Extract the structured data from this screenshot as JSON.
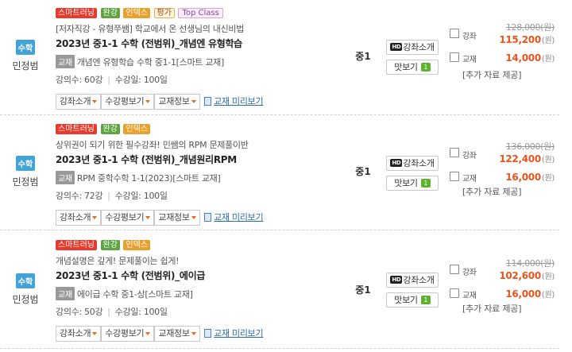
{
  "courses": [
    {
      "subject": "수학",
      "teacher": "민정범",
      "tags": [
        "스마트러닝",
        "완강",
        "인덱스",
        "평가",
        "Top Class"
      ],
      "description": "[저자직강 - 유형쭈쌤] 학교에서 온 선생님의 내신비법",
      "title": "2023년 중1-1 수학 (전범위)_개념엔 유형학습",
      "book_badge": "교재",
      "book": "개념엔 유형학습 수학 중1-1[스마트 교재]",
      "lecture_count": "강의수: 60강",
      "duration": "수강일: 100일",
      "btn_intro": "강좌소개",
      "btn_review": "수강평보기",
      "btn_bookinfo": "교재정보",
      "preview_link": "교재 미리보기",
      "grade": "중1",
      "act_intro": "강좌소개",
      "act_sample": "맛보기",
      "act_sample_badge": "1",
      "lecture_label": "강좌",
      "orig_price": "128,000(원)",
      "sale_price": "115,200",
      "won": "(원)",
      "book_label": "교재",
      "book_price": "14,000",
      "extra": "[추가 자료 제공]"
    },
    {
      "subject": "수학",
      "teacher": "민정범",
      "tags": [
        "스마트러닝",
        "완강",
        "인덱스"
      ],
      "description": "상위권이 되기 위한 필수강좌! 민쌤의 RPM 문제풀이반",
      "title": "2023년 중1-1 수학 (전범위)_개념원리RPM",
      "book_badge": "교재",
      "book": "RPM 중학수학 1-1(2023)[스마트 교재]",
      "lecture_count": "강의수: 72강",
      "duration": "수강일: 100일",
      "btn_intro": "강좌소개",
      "btn_review": "수강평보기",
      "btn_bookinfo": "교재정보",
      "preview_link": "교재 미리보기",
      "grade": "중1",
      "act_intro": "강좌소개",
      "act_sample": "맛보기",
      "act_sample_badge": "1",
      "lecture_label": "강좌",
      "orig_price": "136,000(원)",
      "sale_price": "122,400",
      "won": "(원)",
      "book_label": "교재",
      "book_price": "16,000",
      "extra": "[추가 자료 제공]"
    },
    {
      "subject": "수학",
      "teacher": "민정범",
      "tags": [
        "스마트러닝",
        "완강",
        "인덱스"
      ],
      "description": "개념설명은 깊게! 문제풀이는 쉽게!",
      "title": "2023년 중1-1 수학 (전범위)_에이급",
      "book_badge": "교재",
      "book": "에이급 수학 중1-상[스마트 교재]",
      "lecture_count": "강의수: 50강",
      "duration": "수강일: 100일",
      "btn_intro": "강좌소개",
      "btn_review": "수강평보기",
      "btn_bookinfo": "교재정보",
      "preview_link": "교재 미리보기",
      "grade": "중1",
      "act_intro": "강좌소개",
      "act_sample": "맛보기",
      "act_sample_badge": "1",
      "lecture_label": "강좌",
      "orig_price": "114,000(원)",
      "sale_price": "102,600",
      "won": "(원)",
      "book_label": "교재",
      "book_price": "16,000",
      "extra": "[추가 자료 제공]"
    }
  ],
  "icons": {
    "hd_badge": "HD",
    "preview_icon": "book-icon"
  },
  "colors": {
    "subject_badge": "#41a3d7",
    "tag_smart": "#e83b2e",
    "tag_done": "#5fa342",
    "tag_index": "#e9a12e",
    "sale_price": "#e8541e",
    "link": "#2a6cb0"
  }
}
